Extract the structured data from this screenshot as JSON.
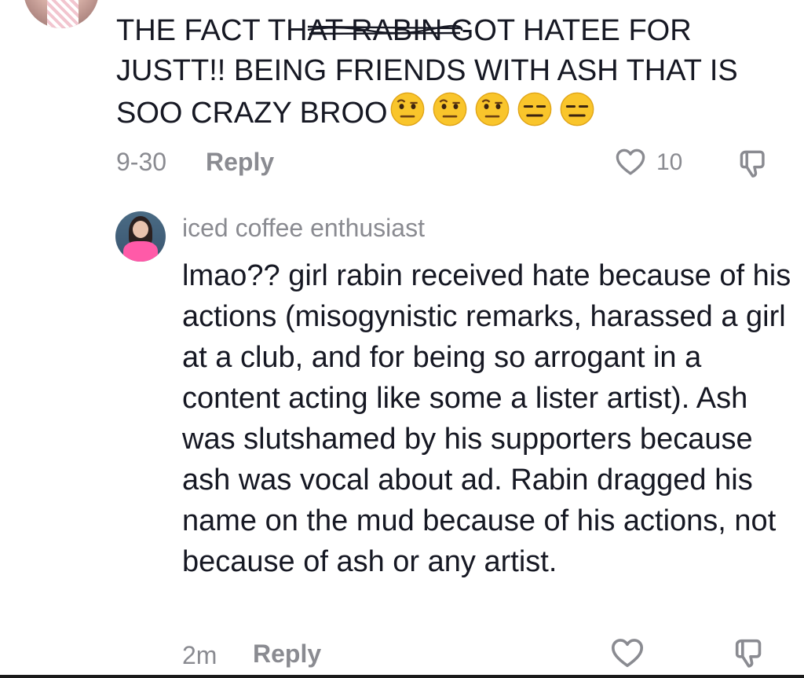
{
  "comment1": {
    "text_before": "THE FACT TH",
    "text_struck": "AT RABIN G",
    "text_after": "OT HATEE FOR JUSTT!! BEING FRIENDS WITH ASH THAT IS SOO CRAZY BROO",
    "emojis": [
      "face-with-raised-eyebrow",
      "face-with-raised-eyebrow",
      "face-with-raised-eyebrow",
      "expressionless-face",
      "expressionless-face"
    ],
    "date": "9-30",
    "reply_label": "Reply",
    "like_count": "10"
  },
  "comment2": {
    "username": "iced coffee enthusiast",
    "text": "lmao?? girl rabin received hate because of his actions (misogynistic remarks, harassed a girl at a club, and for being so arrogant in a content acting like some a lister artist). Ash was slutshamed by his supporters because ash was vocal about ad. Rabin dragged his name on the mud because of his actions, not because of ash or any artist.",
    "time": "2m",
    "reply_label": "Reply"
  },
  "icons": {
    "like": "heart-outline-icon",
    "dislike": "thumbs-down-outline-icon"
  },
  "colors": {
    "text": "#161823",
    "muted": "#8a8b91",
    "emoji": "#f9c52b"
  }
}
